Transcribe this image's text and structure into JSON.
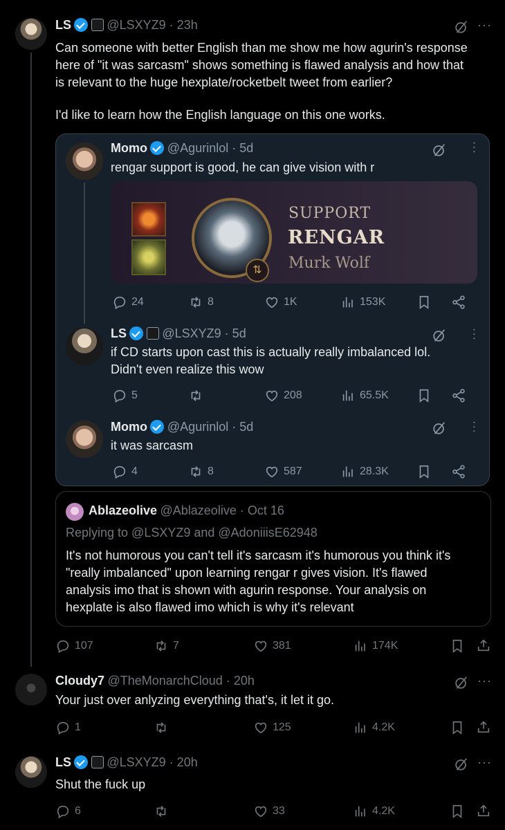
{
  "main_tweet": {
    "name": "LS",
    "handle": "@LSXYZ9 · 23h",
    "text_lines": [
      "Can someone with better English than me show me how agurin's response",
      "here of \"it was sarcasm\" shows something is flawed analysis and how that",
      "is relevant to the huge hexplate/rocketbelt tweet from earlier?"
    ],
    "text2": "I'd like to learn how the English language on this one works.",
    "actions": {
      "reply": "107",
      "retweet": "7",
      "like": "381",
      "views": "174K"
    }
  },
  "embedded": {
    "momo1": {
      "name": "Momo",
      "handle": "@Agurinlol · 5d",
      "text": "rengar support is good, he can give vision with r",
      "media": {
        "line1": "SUPPORT",
        "line2": "RENGAR",
        "line3": "Murk Wolf"
      },
      "actions": {
        "reply": "24",
        "retweet": "8",
        "like": "1K",
        "views": "153K"
      }
    },
    "ls": {
      "name": "LS",
      "handle": "@LSXYZ9 · 5d",
      "text_lines": [
        "if CD starts upon cast this is actually really imbalanced lol.",
        "Didn't even realize this wow"
      ],
      "actions": {
        "reply": "5",
        "retweet": "",
        "like": "208",
        "views": "65.5K"
      }
    },
    "momo2": {
      "name": "Momo",
      "handle": "@Agurinlol · 5d",
      "text": "it was sarcasm",
      "actions": {
        "reply": "4",
        "retweet": "8",
        "like": "587",
        "views": "28.3K"
      }
    }
  },
  "quote": {
    "name": "Ablazeolive",
    "handle": "@Ablazeolive · Oct 16",
    "replying": "Replying to @LSXYZ9 and @AdoniiisE62948",
    "text_lines": [
      "It's not humorous you can't tell it's sarcasm it's humorous you think it's",
      "\"really imbalanced\" upon learning rengar r gives vision. It's flawed",
      "analysis imo that is shown with agurin response. Your analysis on",
      "hexplate is also flawed imo which is why it's relevant"
    ]
  },
  "reply1": {
    "name": "Cloudy7",
    "handle": "@TheMonarchCloud · 20h",
    "text": "Your just over anlyzing everything that's, it let it go.",
    "actions": {
      "reply": "1",
      "retweet": "",
      "like": "125",
      "views": "4.2K"
    }
  },
  "reply2": {
    "name": "LS",
    "handle": "@LSXYZ9 · 20h",
    "text": "Shut the fuck up",
    "actions": {
      "reply": "6",
      "retweet": "",
      "like": "33",
      "views": "4.2K"
    }
  },
  "colors": {
    "background": "#000000",
    "card": "#15202b",
    "verified": "#1d9bf0",
    "muted": "#71767b"
  }
}
